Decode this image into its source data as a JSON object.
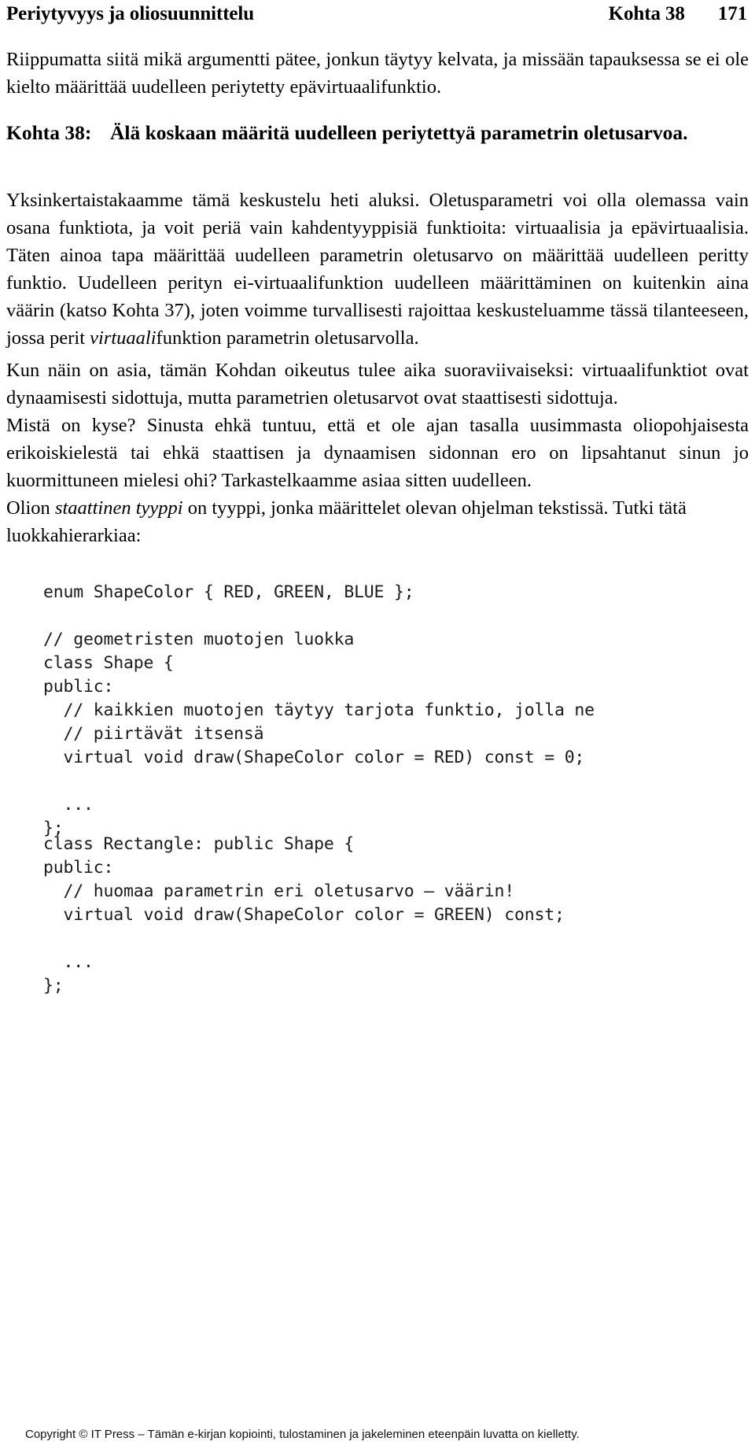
{
  "header": {
    "title": "Periytyvyys ja oliosuunnittelu",
    "section": "Kohta 38",
    "page_number": "171"
  },
  "intro_paragraph": "Riippumatta siitä mikä argumentti pätee, jonkun täytyy kelvata, ja missään tapauksessa se ei ole kielto määrittää uudelleen periytetty epävirtuaalifunktio.",
  "guideline": {
    "label": "Kohta 38:",
    "text": "Älä koskaan määritä uudelleen periytettyä parametrin oletusarvoa."
  },
  "paragraphs": {
    "p1_part1": "Yksinkertaistakaamme tämä keskustelu heti aluksi. Oletusparametri voi olla olemassa vain osana funktiota, ja voit periä vain kahdentyyppisiä funktioita: virtuaalisia ja epävirtuaalisia. Täten ainoa tapa määrittää uudelleen parametrin oletusarvo on määrittää uudelleen peritty funktio. Uudelleen perityn ei-virtuaalifunktion uudelleen määrittäminen on kuitenkin aina väärin (katso Kohta 37), joten voimme turvallisesti rajoittaa keskusteluamme tässä tilanteeseen, jossa perit ",
    "p1_italic": "virtuaali",
    "p1_part2": "funktion parametrin oletusarvolla.",
    "p2": "Kun näin on asia, tämän Kohdan oikeutus tulee aika suoraviivaiseksi: virtuaalifunktiot ovat dynaamisesti sidottuja, mutta parametrien oletusarvot ovat staattisesti sidottuja.",
    "p3": "Mistä on kyse? Sinusta ehkä tuntuu, että et ole ajan tasalla uusimmasta oliopohjaisesta erikoiskielestä tai ehkä staattisen ja dynaamisen sidonnan ero on lipsahtanut sinun jo kuormittuneen mielesi ohi? Tarkastelkaamme asiaa sitten uudelleen.",
    "p4_part1": "Olion ",
    "p4_italic": "staattinen tyyppi",
    "p4_part2": " on tyyppi, jonka määrittelet olevan ohjelman tekstissä. Tutki tätä luokkahierarkiaa:"
  },
  "code": {
    "block1": "enum ShapeColor { RED, GREEN, BLUE };\n\n// geometristen muotojen luokka\nclass Shape {\npublic:\n  // kaikkien muotojen täytyy tarjota funktio, jolla ne\n  // piirtävät itsensä\n  virtual void draw(ShapeColor color = RED) const = 0;\n\n  ...\n};",
    "block2": "class Rectangle: public Shape {\npublic:\n  // huomaa parametrin eri oletusarvo – väärin!\n  virtual void draw(ShapeColor color = GREEN) const;\n\n  ...\n};"
  },
  "footer": {
    "copyright": "Copyright © IT Press – Tämän e-kirjan kopiointi, tulostaminen ja jakeleminen eteenpäin luvatta on kielletty."
  }
}
